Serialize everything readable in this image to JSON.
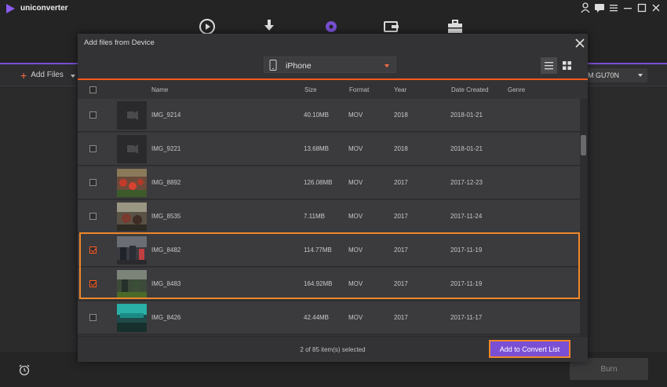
{
  "app": {
    "title": "uniconverter",
    "toolbar": {
      "add_files_label": "Add Files",
      "output_format_value": "M GU70N"
    },
    "burn_label": "Burn",
    "top_icons": [
      "convert-play-icon",
      "download-icon",
      "burn-disc-icon",
      "transfer-icon",
      "toolbox-icon"
    ],
    "window_controls": [
      "user-icon",
      "message-icon",
      "menu-icon",
      "minimize-icon",
      "maximize-icon",
      "close-icon"
    ]
  },
  "dialog": {
    "title": "Add files from Device",
    "device": "iPhone",
    "columns": {
      "name": "Name",
      "size": "Size",
      "format": "Format",
      "year": "Year",
      "date": "Date Created",
      "genre": "Genre"
    },
    "rows": [
      {
        "name": "IMG_9214",
        "size": "40.10MB",
        "format": "MOV",
        "year": "2018",
        "date": "2018-01-21",
        "genre": "",
        "checked": false,
        "thumb": "video-placeholder"
      },
      {
        "name": "IMG_9221",
        "size": "13.68MB",
        "format": "MOV",
        "year": "2018",
        "date": "2018-01-21",
        "genre": "",
        "checked": false,
        "thumb": "video-placeholder"
      },
      {
        "name": "IMG_8892",
        "size": "126.08MB",
        "format": "MOV",
        "year": "2017",
        "date": "2017-12-23",
        "genre": "",
        "checked": false,
        "thumb": "photo"
      },
      {
        "name": "IMG_8535",
        "size": "7.11MB",
        "format": "MOV",
        "year": "2017",
        "date": "2017-11-24",
        "genre": "",
        "checked": false,
        "thumb": "photo"
      },
      {
        "name": "IMG_8482",
        "size": "114.77MB",
        "format": "MOV",
        "year": "2017",
        "date": "2017-11-19",
        "genre": "",
        "checked": true,
        "thumb": "photo"
      },
      {
        "name": "IMG_8483",
        "size": "164.92MB",
        "format": "MOV",
        "year": "2017",
        "date": "2017-11-19",
        "genre": "",
        "checked": true,
        "thumb": "photo"
      },
      {
        "name": "IMG_8426",
        "size": "42.44MB",
        "format": "MOV",
        "year": "2017",
        "date": "2017-11-17",
        "genre": "",
        "checked": false,
        "thumb": "photo"
      }
    ],
    "selection_status": "2 of 85 item(s) selected",
    "add_button_label": "Add to Convert List"
  },
  "colors": {
    "accent_purple": "#7a4fd4",
    "accent_orange": "#ff5a1f",
    "highlight_frame": "#f0872a"
  }
}
